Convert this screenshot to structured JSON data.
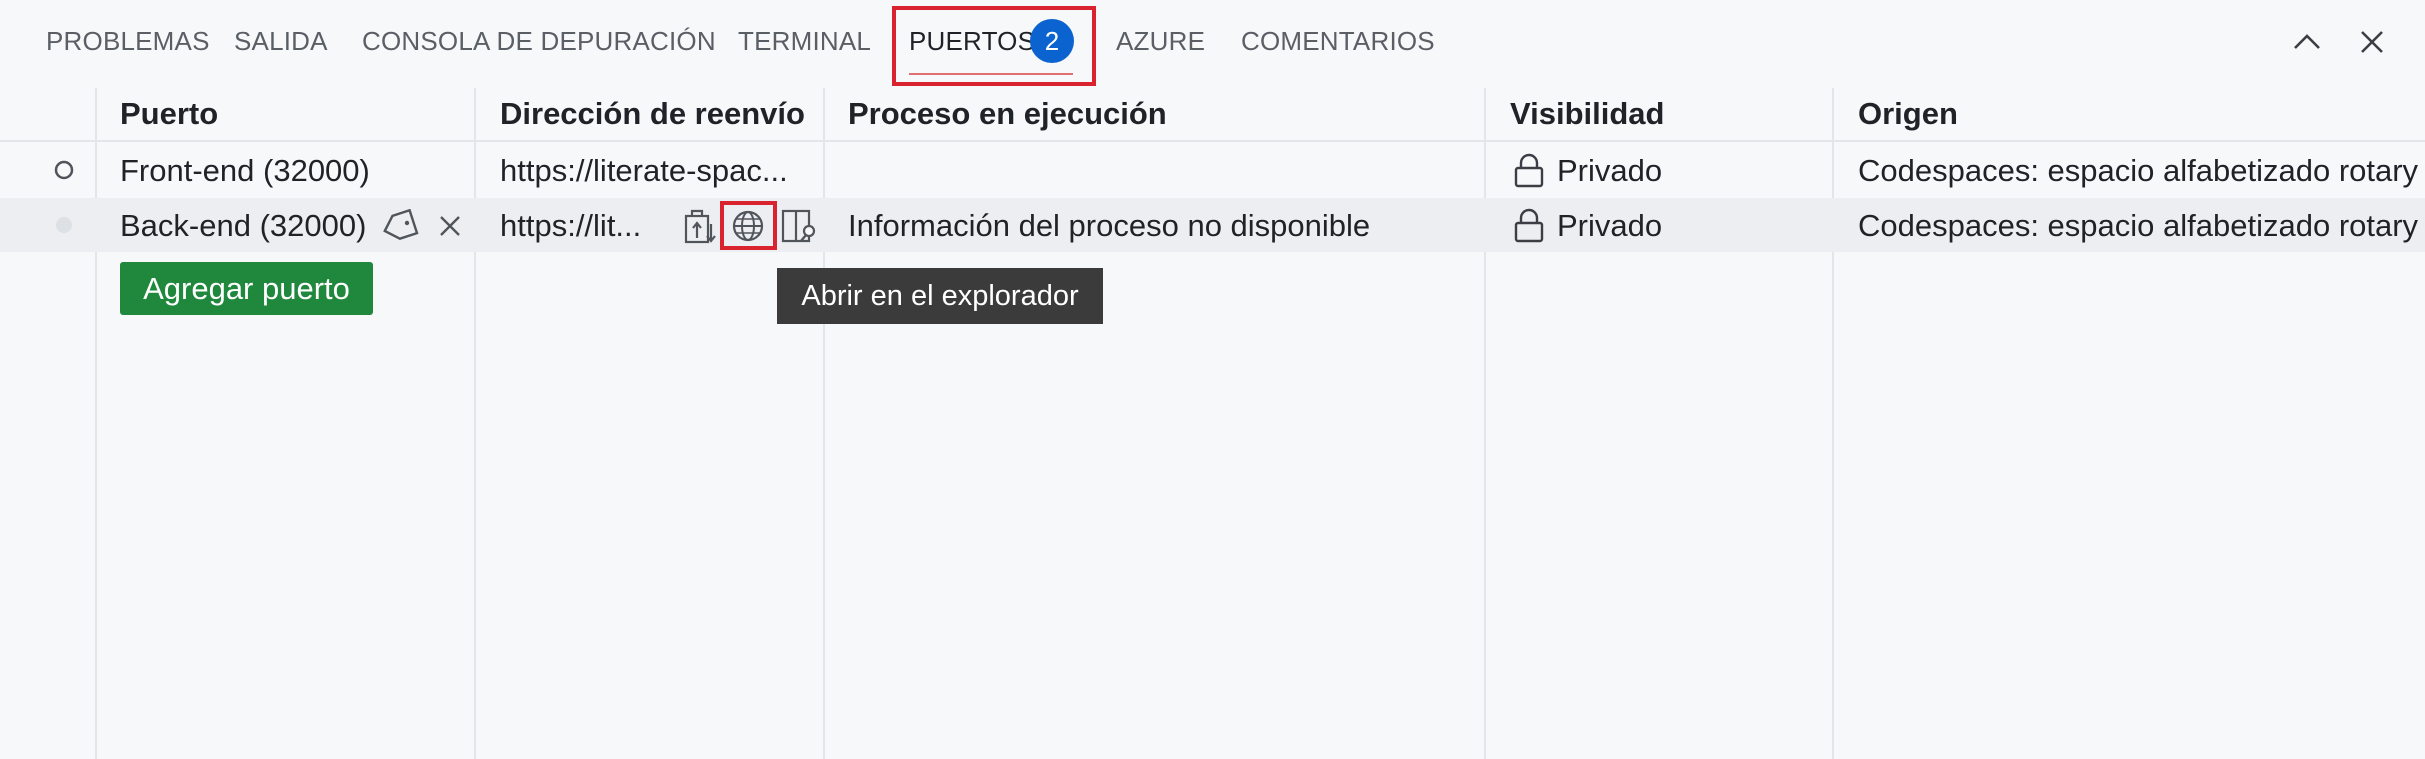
{
  "panel": {
    "tabs": [
      {
        "label": "PROBLEMAS"
      },
      {
        "label": "SALIDA"
      },
      {
        "label": "CONSOLA DE DEPURACIÓN"
      },
      {
        "label": "TERMINAL"
      },
      {
        "label": "PUERTOS",
        "badge": "2",
        "active": true
      },
      {
        "label": "AZURE"
      },
      {
        "label": "COMENTARIOS"
      }
    ],
    "icons": {
      "maximize": "chevron-up-icon",
      "close": "close-icon"
    }
  },
  "table": {
    "columns": [
      "Puerto",
      "Dirección de reenvío",
      "Proceso en ejecución",
      "Visibilidad",
      "Origen"
    ],
    "rows": [
      {
        "status": "circle-outline",
        "port": "Front-end (32000)",
        "address": "https://literate-spac...",
        "process": "",
        "visibility": "Privado",
        "origin": "Codespaces: espacio alfabetizado rotary"
      },
      {
        "status": "dot",
        "port": "Back-end (32000)",
        "address": "https://lit...",
        "process": "Información del proceso no disponible",
        "visibility": "Privado",
        "origin": "Codespaces: espacio alfabetizado rotary"
      }
    ],
    "add_port_label": "Agregar puerto"
  },
  "tooltip": {
    "text": "Abrir en el explorador"
  },
  "colors": {
    "accent": "#0b63cf",
    "highlight": "#d9232e",
    "button": "#1f883d"
  }
}
